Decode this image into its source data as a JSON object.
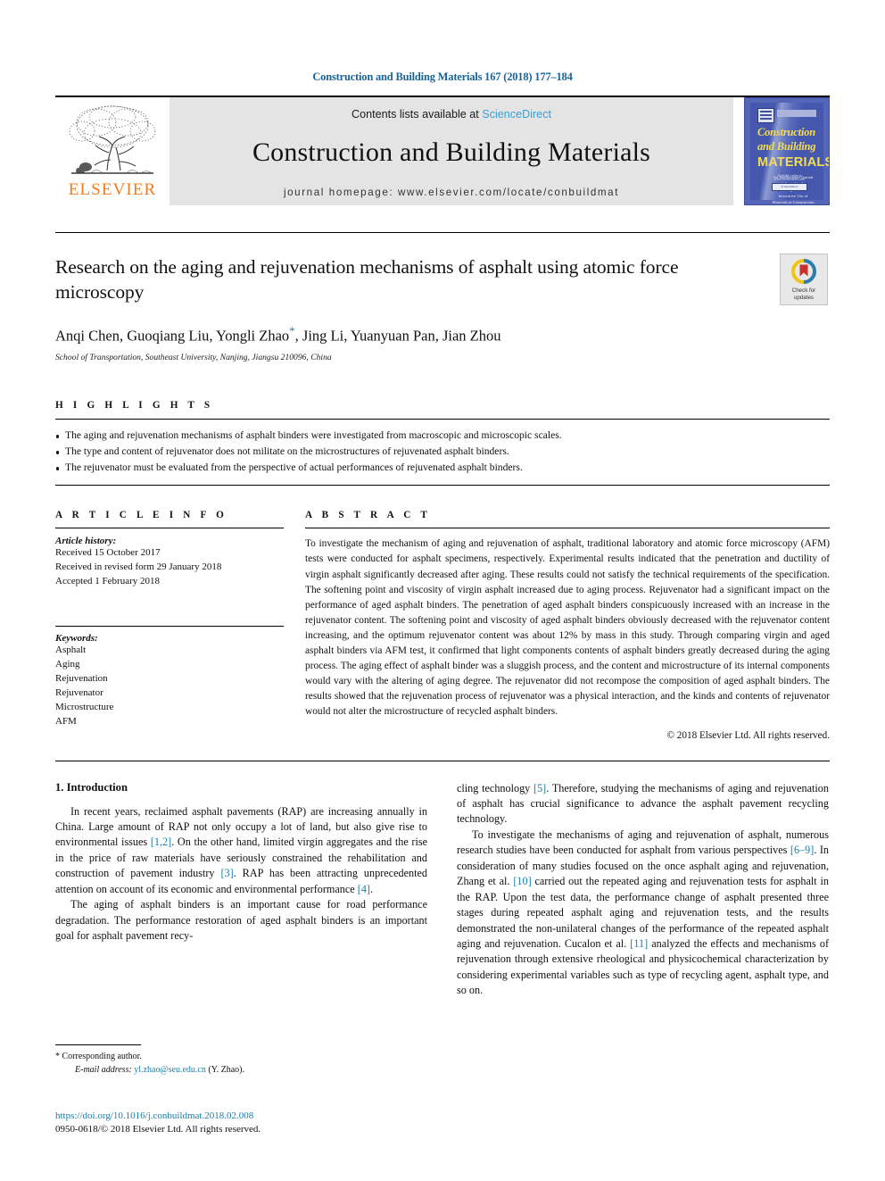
{
  "running_head": "Construction and Building Materials 167 (2018) 177–184",
  "masthead": {
    "contents_prefix": "Contents lists available at ",
    "sciencedirect": "ScienceDirect",
    "journal_title": "Construction and Building Materials",
    "homepage": "journal homepage: www.elsevier.com/locate/conbuildmat",
    "publisher": "ELSEVIER",
    "cover": {
      "line1": "Construction",
      "line2": "and Building",
      "line3": "MATERIALS",
      "blurb": "An International Journal dedicated to the Investigation and Innovative Use of Materials in Construction and Repair",
      "foot_text": "Available online at www.sciencedirect.com",
      "foot_badge": "ScienceDirect"
    }
  },
  "article": {
    "title": "Research on the aging and rejuvenation mechanisms of asphalt using atomic force microscopy",
    "authors": "Anqi Chen, Guoqiang Liu, Yongli Zhao",
    "authors_tail": ", Jing Li, Yuanyuan Pan, Jian Zhou",
    "corresponding_mark": "*",
    "affiliation": "School of Transportation, Southeast University, Nanjing, Jiangsu 210096, China",
    "crossmark_line1": "Check for",
    "crossmark_line2": "updates"
  },
  "highlights": {
    "heading": "H I G H L I G H T S",
    "items": [
      "The aging and rejuvenation mechanisms of asphalt binders were investigated from macroscopic and microscopic scales.",
      "The type and content of rejuvenator does not militate on the microstructures of rejuvenated asphalt binders.",
      "The rejuvenator must be evaluated from the perspective of actual performances of rejuvenated asphalt binders."
    ]
  },
  "article_info": {
    "heading": "A R T I C L E   I N F O",
    "history_label": "Article history:",
    "history": [
      "Received 15 October 2017",
      "Received in revised form 29 January 2018",
      "Accepted 1 February 2018"
    ],
    "keywords_label": "Keywords:",
    "keywords": [
      "Asphalt",
      "Aging",
      "Rejuvenation",
      "Rejuvenator",
      "Microstructure",
      "AFM"
    ]
  },
  "abstract": {
    "heading": "A B S T R A C T",
    "text": "To investigate the mechanism of aging and rejuvenation of asphalt, traditional laboratory and atomic force microscopy (AFM) tests were conducted for asphalt specimens, respectively. Experimental results indicated that the penetration and ductility of virgin asphalt significantly decreased after aging. These results could not satisfy the technical requirements of the specification. The softening point and viscosity of virgin asphalt increased due to aging process. Rejuvenator had a significant impact on the performance of aged asphalt binders. The penetration of aged asphalt binders conspicuously increased with an increase in the rejuvenator content. The softening point and viscosity of aged asphalt binders obviously decreased with the rejuvenator content increasing, and the optimum rejuvenator content was about 12% by mass in this study. Through comparing virgin and aged asphalt binders via AFM test, it confirmed that light components contents of asphalt binders greatly decreased during the aging process. The aging effect of asphalt binder was a sluggish process, and the content and microstructure of its internal components would vary with the altering of aging degree. The rejuvenator did not recompose the composition of aged asphalt binders. The results showed that the rejuvenation process of rejuvenator was a physical interaction, and the kinds and contents of rejuvenator would not alter the microstructure of recycled asphalt binders.",
    "copyright": "© 2018 Elsevier Ltd. All rights reserved."
  },
  "body": {
    "section_heading": "1. Introduction",
    "left_para1_a": "In recent years, reclaimed asphalt pavements (RAP) are increasing annually in China. Large amount of RAP not only occupy a lot of land, but also give rise to environmental issues ",
    "left_para1_cite1": "[1,2]",
    "left_para1_b": ". On the other hand, limited virgin aggregates and the rise in the price of raw materials have seriously constrained the rehabilitation and construction of pavement industry ",
    "left_para1_cite2": "[3]",
    "left_para1_c": ". RAP has been attracting unprecedented attention on account of its economic and environmental performance ",
    "left_para1_cite3": "[4]",
    "left_para1_d": ".",
    "left_para2": "The aging of asphalt binders is an important cause for road performance degradation. The performance restoration of aged asphalt binders is an important goal for asphalt pavement recy-",
    "right_para1_a": "cling technology ",
    "right_para1_cite1": "[5]",
    "right_para1_b": ". Therefore, studying the mechanisms of aging and rejuvenation of asphalt has crucial significance to advance the asphalt pavement recycling technology.",
    "right_para2_a": "To investigate the mechanisms of aging and rejuvenation of asphalt, numerous research studies have been conducted for asphalt from various perspectives ",
    "right_para2_cite1": "[6–9]",
    "right_para2_b": ". In consideration of many studies focused on the once asphalt aging and rejuvenation, Zhang et al. ",
    "right_para2_cite2": "[10]",
    "right_para2_c": " carried out the repeated aging and rejuvenation tests for asphalt in the RAP. Upon the test data, the performance change of asphalt presented three stages during repeated asphalt aging and rejuvenation tests, and the results demonstrated the non-unilateral changes of the performance of the repeated asphalt aging and rejuvenation. Cucalon et al. ",
    "right_para2_cite3": "[11]",
    "right_para2_d": " analyzed the effects and mechanisms of rejuvenation through extensive rheological and physicochemical characterization by considering experimental variables such as type of recycling agent, asphalt type, and so on."
  },
  "footnote": {
    "corresponding_mark": "*",
    "corresponding_text": "Corresponding author.",
    "email_label": "E-mail address:",
    "email": "yl.zhao@seu.edu.cn",
    "email_owner": "(Y. Zhao)."
  },
  "doi": {
    "url": "https://doi.org/10.1016/j.conbuildmat.2018.02.008",
    "issn": "0950-0618/© 2018 Elsevier Ltd. All rights reserved."
  },
  "colors": {
    "link": "#1a7fa8",
    "elsevier_orange": "#ef7d22",
    "sciencedirect_blue": "#3b9fd4",
    "running_head_blue": "#1a6496",
    "cover_blue": "#4558ae",
    "cover_yellow": "#f4dd55"
  }
}
